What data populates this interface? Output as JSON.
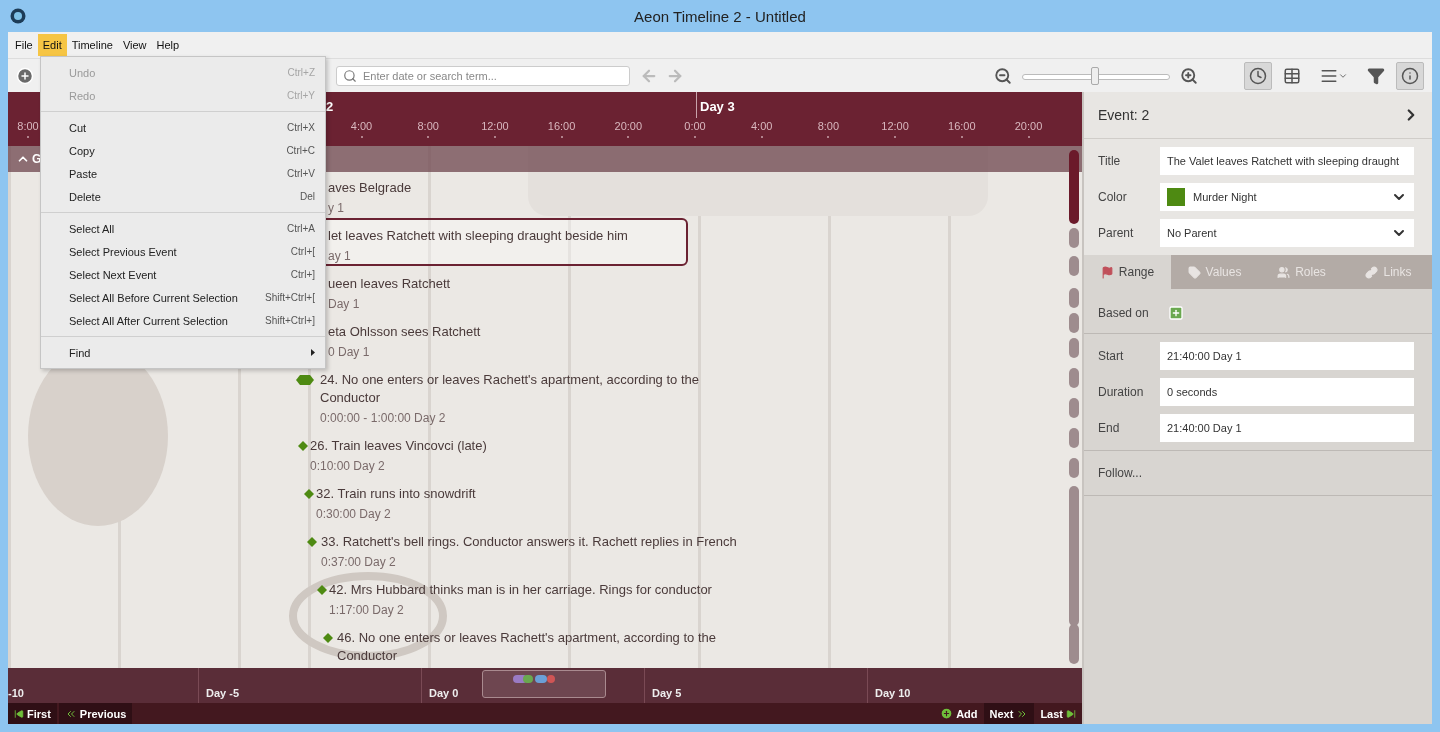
{
  "window": {
    "title": "Aeon Timeline 2 - Untitled"
  },
  "menu_bar": [
    {
      "label": "File",
      "selected": false
    },
    {
      "label": "Edit",
      "selected": true
    },
    {
      "label": "Timeline",
      "selected": false
    },
    {
      "label": "View",
      "selected": false
    },
    {
      "label": "Help",
      "selected": false
    }
  ],
  "edit_menu": {
    "sections": [
      [
        {
          "label": "Undo",
          "shortcut": "Ctrl+Z",
          "disabled": true
        },
        {
          "label": "Redo",
          "shortcut": "Ctrl+Y",
          "disabled": true
        }
      ],
      [
        {
          "label": "Cut",
          "shortcut": "Ctrl+X",
          "disabled": false
        },
        {
          "label": "Copy",
          "shortcut": "Ctrl+C",
          "disabled": false
        },
        {
          "label": "Paste",
          "shortcut": "Ctrl+V",
          "disabled": false
        },
        {
          "label": "Delete",
          "shortcut": "Del",
          "disabled": false
        }
      ],
      [
        {
          "label": "Select All",
          "shortcut": "Ctrl+A",
          "disabled": false
        },
        {
          "label": "Select Previous Event",
          "shortcut": "Ctrl+[",
          "disabled": false
        },
        {
          "label": "Select Next Event",
          "shortcut": "Ctrl+]",
          "disabled": false
        },
        {
          "label": "Select All Before Current Selection",
          "shortcut": "Shift+Ctrl+[",
          "disabled": false
        },
        {
          "label": "Select All After Current Selection",
          "shortcut": "Shift+Ctrl+]",
          "disabled": false
        }
      ],
      [
        {
          "label": "Find",
          "submenu": true,
          "disabled": false
        }
      ]
    ]
  },
  "toolbar": {
    "search": {
      "placeholder": "Enter date or search term..."
    },
    "zoom": {
      "level": 0.49
    },
    "view_buttons": [
      {
        "kind": "timeline",
        "selected": true
      },
      {
        "kind": "spreadsheet",
        "selected": false
      },
      {
        "kind": "list",
        "selected": false
      },
      {
        "kind": "filter",
        "selected": false
      },
      {
        "kind": "inspector",
        "selected": true
      }
    ]
  },
  "timeline": {
    "days": [
      {
        "label": "2"
      },
      {
        "label": "Day 3"
      }
    ],
    "ticks": [
      "8:00",
      "4:00",
      "8:00",
      "12:00",
      "16:00",
      "20:00",
      "0:00",
      "4:00",
      "8:00",
      "12:00",
      "16:00",
      "20:00"
    ],
    "group": {
      "label": "G",
      "expanded": true
    },
    "events": [
      {
        "title": "aves Belgrade",
        "time": "y 1",
        "selected": false
      },
      {
        "title": "let leaves Ratchett with sleeping draught beside him",
        "time": "ay 1",
        "selected": true
      },
      {
        "title": "ueen leaves Ratchett",
        "time": "Day 1",
        "selected": false
      },
      {
        "title": "eta Ohlsson sees Ratchett",
        "time": "0 Day 1",
        "selected": false
      },
      {
        "title": "24. No one enters or leaves Rachett's apartment, according to the Conductor",
        "time": "0:00:00 - 1:00:00 Day 2",
        "selected": false,
        "kind": "range",
        "color": "#4e8a12"
      },
      {
        "title": "26. Train leaves Vincovci (late)",
        "time": "0:10:00 Day 2",
        "selected": false,
        "kind": "point",
        "color": "#4e8a12"
      },
      {
        "title": "32. Train runs into snowdrift",
        "time": "0:30:00 Day 2",
        "selected": false,
        "kind": "point",
        "color": "#4e8a12"
      },
      {
        "title": "33. Ratchett's bell rings. Conductor answers it. Rachett replies in French",
        "time": "0:37:00 Day 2",
        "selected": false,
        "kind": "point",
        "color": "#4e8a12"
      },
      {
        "title": "42. Mrs Hubbard thinks man is in her carriage. Rings for conductor",
        "time": "1:17:00 Day 2",
        "selected": false,
        "kind": "point",
        "color": "#4e8a12"
      },
      {
        "title": "46. No one enters or leaves Rachett's apartment, according to the Conductor",
        "selected": false,
        "kind": "point",
        "color": "#4e8a12"
      }
    ],
    "overview": [
      "-10",
      "Day -5",
      "Day 0",
      "Day 5",
      "Day 10"
    ],
    "nav": {
      "first": "First",
      "previous": "Previous",
      "add": "Add",
      "next": "Next",
      "last": "Last"
    }
  },
  "inspector": {
    "heading": "Event: 2",
    "title": {
      "label": "Title",
      "value": "The Valet leaves Ratchett with sleeping draught"
    },
    "color": {
      "label": "Color",
      "value": "Murder Night",
      "color": "#4e8a12"
    },
    "parent": {
      "label": "Parent",
      "value": "No Parent"
    },
    "tabs": [
      {
        "label": "Range",
        "kind": "range",
        "selected": true
      },
      {
        "label": "Values",
        "kind": "values",
        "selected": false
      },
      {
        "label": "Roles",
        "kind": "roles",
        "selected": false
      },
      {
        "label": "Links",
        "kind": "links",
        "selected": false
      }
    ],
    "based_on": "Based on",
    "range": [
      {
        "label": "Start",
        "value": "21:40:00 Day 1"
      },
      {
        "label": "Duration",
        "value": "0 seconds"
      },
      {
        "label": "End",
        "value": "21:40:00 Day 1"
      }
    ],
    "follow": "Follow..."
  }
}
